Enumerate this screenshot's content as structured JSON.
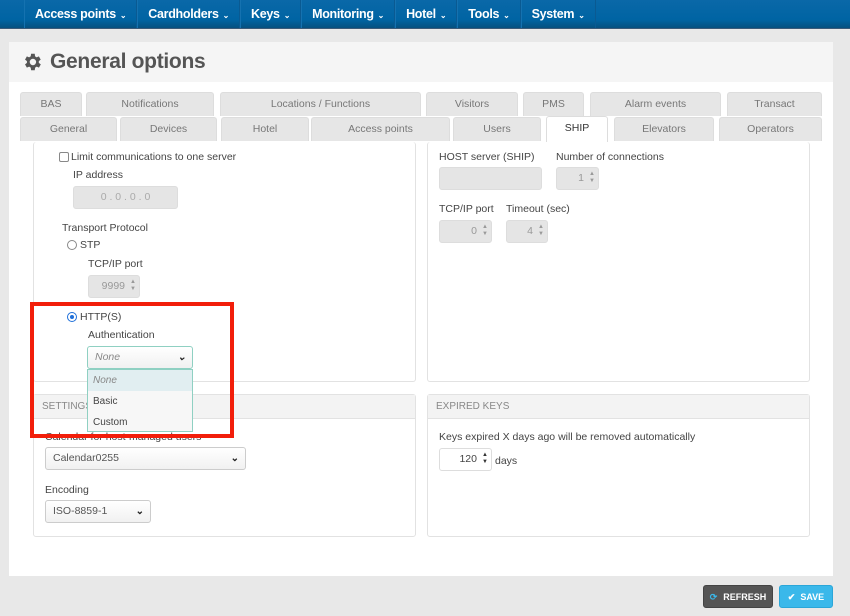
{
  "navbar": {
    "items": [
      {
        "label": "Access points",
        "caret": "⌄"
      },
      {
        "label": "Cardholders",
        "caret": "⌄"
      },
      {
        "label": "Keys",
        "caret": "⌄"
      },
      {
        "label": "Monitoring",
        "caret": "⌄"
      },
      {
        "label": "Hotel",
        "caret": "⌄"
      },
      {
        "label": "Tools",
        "caret": "⌄"
      },
      {
        "label": "System",
        "caret": "⌄"
      }
    ]
  },
  "page": {
    "title": "General options",
    "icon": "gear-icon"
  },
  "tabs": {
    "row1": [
      "BAS",
      "Notifications",
      "Locations / Functions",
      "Visitors",
      "PMS",
      "Alarm events",
      "Transact"
    ],
    "row2": [
      "General",
      "Devices",
      "Hotel",
      "Access points",
      "Users",
      "SHIP",
      "Elevators",
      "Operators"
    ],
    "active": "SHIP"
  },
  "ship_left": {
    "limit_label": "Limit communications to one server",
    "limit_checked": false,
    "ip_label": "IP address",
    "ip_value": "0 . 0 . 0 . 0",
    "transport_label": "Transport Protocol",
    "stp_label": "STP",
    "stp_port_label": "TCP/IP port",
    "stp_port_value": "9999",
    "http_label": "HTTP(S)",
    "selected_protocol": "HTTP(S)",
    "auth_label": "Authentication",
    "auth_value": "None",
    "auth_options": [
      "None",
      "Basic",
      "Custom"
    ]
  },
  "ship_right": {
    "host_label": "HOST server (SHIP)",
    "host_value": "",
    "connections_label": "Number of connections",
    "connections_value": "1",
    "port_label": "TCP/IP port",
    "port_value": "0",
    "timeout_label": "Timeout (sec)",
    "timeout_value": "4"
  },
  "settings": {
    "header": "SETTINGS",
    "calendar_label": "Calendar for host-managed users",
    "calendar_value": "Calendar0255",
    "encoding_label": "Encoding",
    "encoding_value": "ISO-8859-1"
  },
  "expired_keys": {
    "header": "EXPIRED KEYS",
    "description": "Keys expired X days ago will be removed automatically",
    "days_value": "120",
    "days_unit": "days"
  },
  "buttons": {
    "refresh": "REFRESH",
    "save": "SAVE"
  },
  "colors": {
    "nav": "#0064a3",
    "save": "#3ab8ea",
    "refresh": "#555555",
    "highlight": "#f21e0a"
  }
}
